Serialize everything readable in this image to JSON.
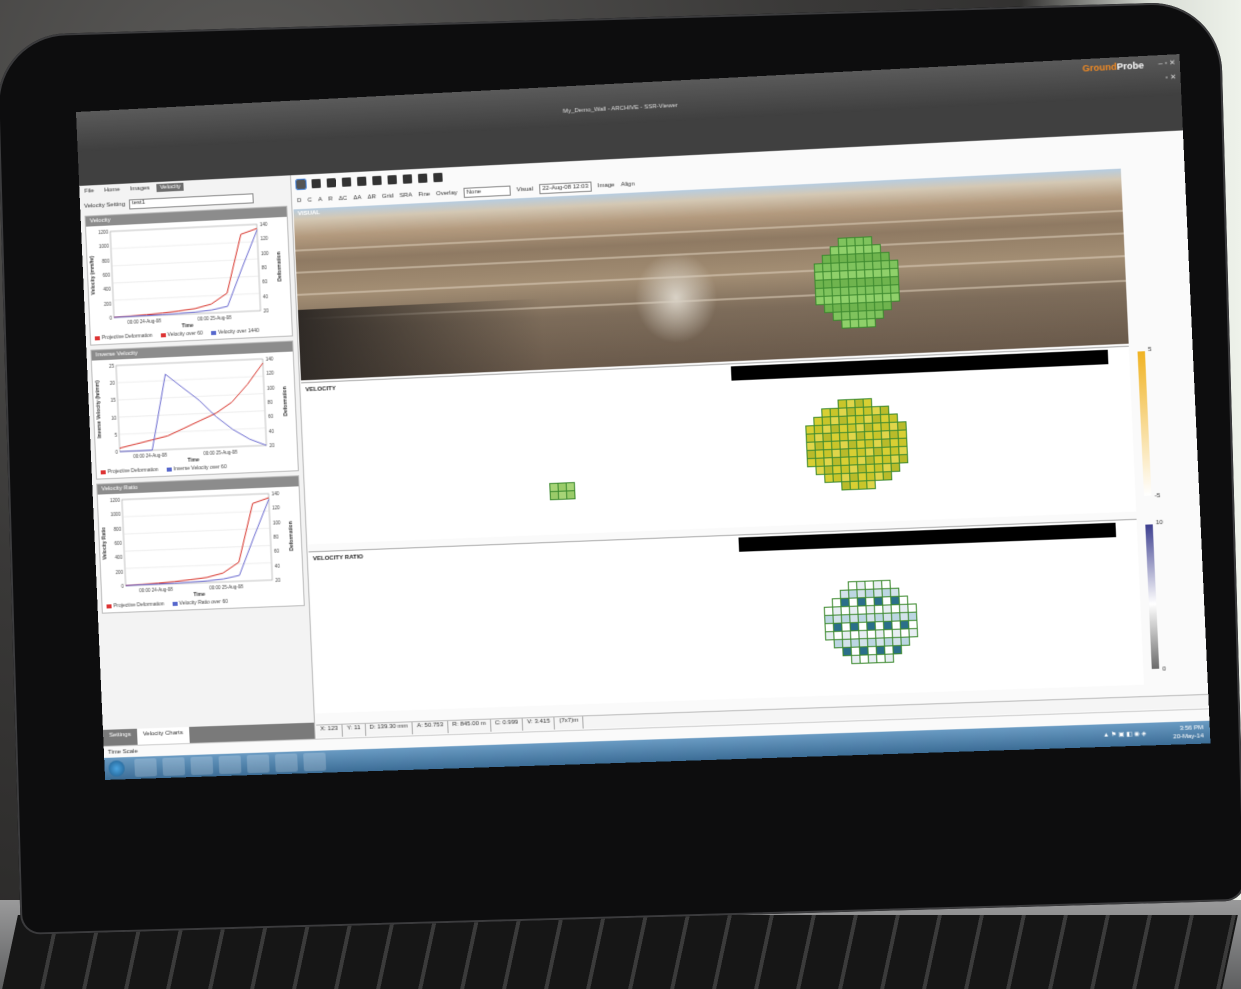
{
  "window": {
    "title": "My_Demo_Wall - ARCHIVE - SSR-Viewer",
    "brand_part1": "Ground",
    "brand_part2": "Probe",
    "controls": "– ▫ ✕",
    "controls2": "▫ ✕"
  },
  "menu": {
    "tabs": [
      "File",
      "Home",
      "Images",
      "Velocity"
    ]
  },
  "velocity_setting": {
    "label": "Velocity Setting",
    "value": "test1"
  },
  "charts": [
    {
      "header": "Velocity",
      "ylabel": "Velocity (mm/hr)",
      "y2label": "Deformation",
      "xlabel": "Time",
      "xticks": [
        "00:00 24-Aug-08",
        "00:00 25-Aug-08"
      ],
      "yticks": [
        "1200",
        "1000",
        "800",
        "600",
        "400",
        "200",
        "0"
      ],
      "y2ticks": [
        "140",
        "120",
        "100",
        "80",
        "60",
        "40",
        "20"
      ],
      "legend": [
        "Projective Deformation",
        "Velocity over 60",
        "Velocity over 1440"
      ]
    },
    {
      "header": "Inverse Velocity",
      "ylabel": "Inverse Velocity (hr/mm)",
      "y2label": "Deformation",
      "xlabel": "Time",
      "xticks": [
        "00:00 24-Aug-08",
        "00:00 25-Aug-08"
      ],
      "yticks": [
        "25",
        "20",
        "15",
        "10",
        "5",
        "0"
      ],
      "y2ticks": [
        "140",
        "120",
        "100",
        "80",
        "60",
        "40",
        "20"
      ],
      "legend": [
        "Projective Deformation",
        "Inverse Velocity over 60"
      ]
    },
    {
      "header": "Velocity Ratio",
      "ylabel": "Velocity Ratio",
      "y2label": "Deformation",
      "xlabel": "Time",
      "xticks": [
        "00:00 24-Aug-08",
        "00:00 25-Aug-08"
      ],
      "yticks": [
        "1200",
        "1000",
        "800",
        "600",
        "400",
        "200",
        "0"
      ],
      "y2ticks": [
        "140",
        "120",
        "100",
        "80",
        "60",
        "40",
        "20"
      ],
      "legend": [
        "Projective Deformation",
        "Velocity Ratio over 60"
      ]
    }
  ],
  "bottom_tabs": [
    "Settings",
    "Velocity Charts"
  ],
  "subtoolbar": {
    "buttons": [
      "D",
      "C",
      "A",
      "R",
      "ΔC",
      "ΔA",
      "ΔR"
    ],
    "grid": "Grid",
    "sra": "SRA",
    "fine": "Fine",
    "overlay_label": "Overlay",
    "overlay_value": "None",
    "visual_label": "Visual",
    "visual_value": "22-Aug-08 12:03",
    "image": "Image",
    "align": "Align"
  },
  "panels": {
    "visual": "VISUAL",
    "velocity": "VELOCITY",
    "velocity_ratio": "VELOCITY RATIO"
  },
  "colorbars": {
    "velocity": {
      "max": "5",
      "min": "-5",
      "colors": [
        "#f0b323",
        "#ffffff"
      ]
    },
    "velocity_ratio": {
      "max": "10",
      "min": "0",
      "colors": [
        "#3d3f8f",
        "#ffffff",
        "#6b6b6b"
      ]
    }
  },
  "statusbar": [
    "X: 123",
    "Y: 11",
    "D: 139.30 mm",
    "A: 50.753",
    "R: 845.00 m",
    "C: 0.999",
    "V: 3.415",
    "(7x7)m"
  ],
  "timescale": "Time Scale",
  "taskbar": {
    "time": "3:56 PM",
    "date": "20-May-14"
  },
  "chart_data": [
    {
      "type": "line",
      "title": "Velocity",
      "xlabel": "Time",
      "ylabel": "Velocity (mm/hr)",
      "series": [
        {
          "name": "Projective Deformation",
          "values": [
            5,
            10,
            18,
            30,
            48,
            70,
            120,
            260,
            1050,
            1120
          ]
        },
        {
          "name": "Velocity over 60",
          "values": [
            2,
            4,
            6,
            9,
            14,
            22,
            40,
            80,
            600,
            1100
          ]
        }
      ]
    },
    {
      "type": "line",
      "title": "Inverse Velocity",
      "xlabel": "Time",
      "ylabel": "Inverse Velocity (hr/mm)",
      "series": [
        {
          "name": "Projective Deformation",
          "values": [
            1,
            2,
            3,
            4,
            6,
            8,
            10,
            13,
            18,
            24
          ]
        },
        {
          "name": "Inverse Velocity over 60",
          "values": [
            0,
            0,
            0,
            22,
            18,
            14,
            9,
            5,
            2,
            0
          ]
        }
      ]
    },
    {
      "type": "line",
      "title": "Velocity Ratio",
      "xlabel": "Time",
      "ylabel": "Velocity Ratio",
      "series": [
        {
          "name": "Projective Deformation",
          "values": [
            5,
            10,
            18,
            30,
            48,
            70,
            120,
            260,
            1050,
            1120
          ]
        },
        {
          "name": "Velocity Ratio over 60",
          "values": [
            2,
            4,
            6,
            9,
            14,
            22,
            40,
            80,
            600,
            1100
          ]
        }
      ]
    }
  ]
}
